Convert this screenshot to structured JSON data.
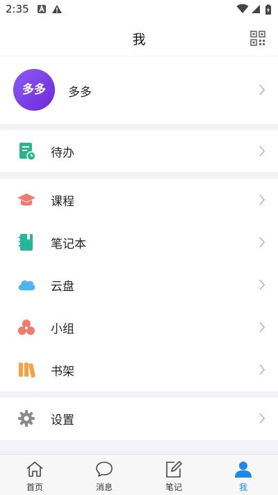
{
  "status": {
    "time": "2:35"
  },
  "header": {
    "title": "我"
  },
  "profile": {
    "avatar_text": "多多",
    "name": "多多"
  },
  "menu": {
    "todo": "待办",
    "course": "课程",
    "notebook": "笔记本",
    "cloud": "云盘",
    "group": "小组",
    "bookshelf": "书架",
    "settings": "设置"
  },
  "tabs": [
    {
      "label": "首页"
    },
    {
      "label": "消息"
    },
    {
      "label": "笔记"
    },
    {
      "label": "我"
    }
  ],
  "colors": {
    "accent": "#1e88e5",
    "todo": "#2bb58f",
    "course": "#f07a6e",
    "notebook": "#26b79a",
    "cloud": "#4db6f2",
    "group": "#f07a6e",
    "bookshelf": "#f5a341",
    "settings": "#8a8a8a"
  }
}
